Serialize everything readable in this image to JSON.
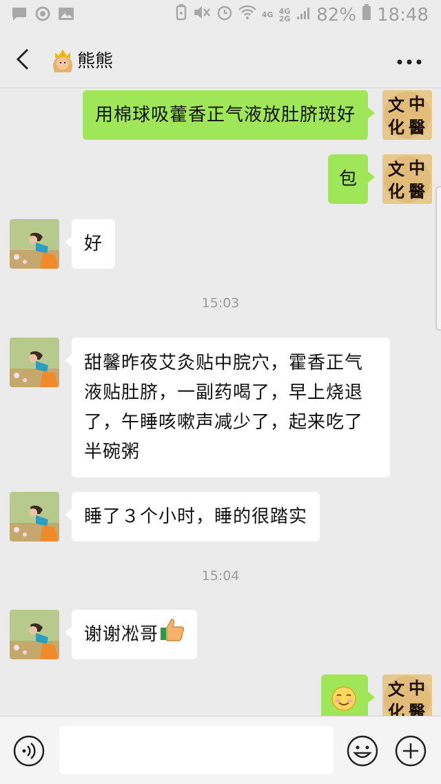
{
  "status_bar": {
    "network_top": "4G",
    "network_bottom": "2G",
    "battery": "82%",
    "time": "18:48"
  },
  "header": {
    "title": "熊熊",
    "avatar_icon": "crown-person-emoji"
  },
  "messages": [
    {
      "side": "me",
      "text": "用棉球吸藿香正气液放肚脐斑好"
    },
    {
      "side": "me",
      "text": "包"
    },
    {
      "side": "them",
      "text": "好"
    },
    {
      "type": "time",
      "text": "15:03"
    },
    {
      "side": "them",
      "lines": [
        "甜馨昨夜艾灸贴中脘穴，霍香正气",
        "液贴肚脐，一副药喝了，早上烧退",
        "了，午睡咳嗽声减少了，起来吃了",
        "半碗粥"
      ]
    },
    {
      "side": "them",
      "text": "睡了３个小时，睡的很踏实"
    },
    {
      "type": "time",
      "text": "15:04"
    },
    {
      "side": "them",
      "text": "谢谢凇哥",
      "emoji": "thumbs-up"
    },
    {
      "side": "me",
      "emoji": "smiling-face"
    }
  ],
  "my_avatar_text": [
    "文",
    "中",
    "化",
    "醫"
  ],
  "input_bar": {
    "placeholder": "",
    "icons": [
      "voice-icon",
      "emoji-icon",
      "plus-icon"
    ]
  },
  "colors": {
    "my_bubble": "#9fe658",
    "their_bubble": "#ffffff",
    "background": "#ebebeb"
  }
}
